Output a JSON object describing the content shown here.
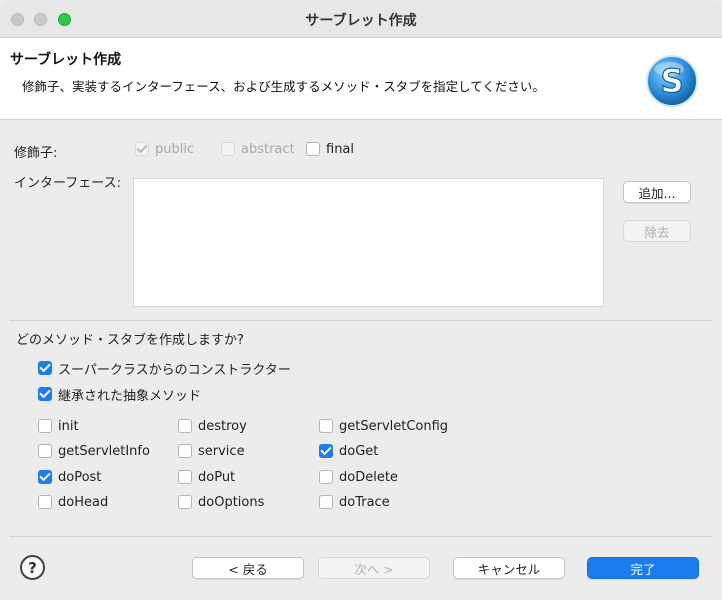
{
  "window": {
    "title": "サーブレット作成"
  },
  "header": {
    "title": "サーブレット作成",
    "description": "修飾子、実装するインターフェース、および生成するメソッド・スタブを指定してください。",
    "logo_icon": "servlet-s-logo-icon"
  },
  "modifiers": {
    "label": "修飾子:",
    "public": {
      "label": "public",
      "checked": true,
      "enabled": false
    },
    "abstract": {
      "label": "abstract",
      "checked": false,
      "enabled": false
    },
    "final": {
      "label": "final",
      "checked": false,
      "enabled": true
    }
  },
  "interfaces": {
    "label": "インターフェース:",
    "items": [],
    "add_label": "追加...",
    "remove_label": "除去"
  },
  "stubs": {
    "question": "どのメソッド・スタブを作成しますか?",
    "superclass_constructor": {
      "label": "スーパークラスからのコンストラクター",
      "checked": true
    },
    "inherited_abstract": {
      "label": "継承された抽象メソッド",
      "checked": true
    },
    "methods": [
      {
        "label": "init",
        "checked": false
      },
      {
        "label": "destroy",
        "checked": false
      },
      {
        "label": "getServletConfig",
        "checked": false
      },
      {
        "label": "getServletInfo",
        "checked": false
      },
      {
        "label": "service",
        "checked": false
      },
      {
        "label": "doGet",
        "checked": true
      },
      {
        "label": "doPost",
        "checked": true
      },
      {
        "label": "doPut",
        "checked": false
      },
      {
        "label": "doDelete",
        "checked": false
      },
      {
        "label": "doHead",
        "checked": false
      },
      {
        "label": "doOptions",
        "checked": false
      },
      {
        "label": "doTrace",
        "checked": false
      }
    ]
  },
  "footer": {
    "help_label": "?",
    "back_label": "< 戻る",
    "next_label": "次へ >",
    "cancel_label": "キャンセル",
    "finish_label": "完了"
  },
  "colors": {
    "accent": "#1b7cf0",
    "logo": "#2f8fd8"
  }
}
